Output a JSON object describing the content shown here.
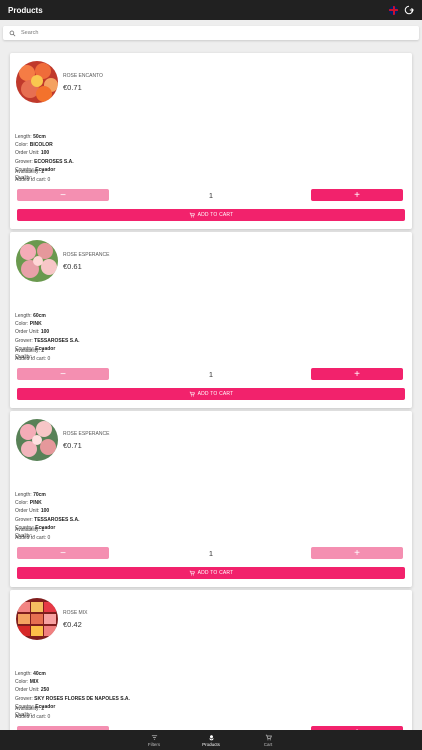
{
  "header": {
    "title": "Products"
  },
  "search": {
    "placeholder": "Search"
  },
  "labels": {
    "length": "Length:",
    "color": "Color:",
    "order_unit": "Order Unit:",
    "grower": "Grower:",
    "country": "Country:",
    "quality": "Quality:",
    "availability": "Availability:",
    "added_to_cart": "Added to cart:",
    "add_to_cart": "ADD TO CART",
    "minus": "−",
    "plus": "+"
  },
  "products": [
    {
      "name": "ROSE ENCANTO",
      "price": "€0.71",
      "length": "50cm",
      "color": "BICOLOR",
      "order_unit": "100",
      "grower": "ECOROSES S.A.",
      "country": "Ecuador",
      "quality": "-",
      "availability": "2",
      "added_to_cart": "0",
      "quantity": "1",
      "plus_enabled": true
    },
    {
      "name": "ROSE ESPERANCE",
      "price": "€0.61",
      "length": "60cm",
      "color": "PINK",
      "order_unit": "100",
      "grower": "TESSAROSES S.A.",
      "country": "Ecuador",
      "quality": "-",
      "availability": "2",
      "added_to_cart": "0",
      "quantity": "1",
      "plus_enabled": true
    },
    {
      "name": "ROSE ESPERANCE",
      "price": "€0.71",
      "length": "70cm",
      "color": "PINK",
      "order_unit": "100",
      "grower": "TESSAROSES S.A.",
      "country": "Ecuador",
      "quality": "-",
      "availability": "1",
      "added_to_cart": "0",
      "quantity": "1",
      "plus_enabled": false
    },
    {
      "name": "ROSE MIX",
      "price": "€0.42",
      "length": "40cm",
      "color": "MIX",
      "order_unit": "250",
      "grower": "SKY ROSES FLORES DE NAPOLES S.A.",
      "country": "Ecuador",
      "quality": "-",
      "availability": "2",
      "added_to_cart": "0",
      "quantity": "1",
      "plus_enabled": true
    }
  ],
  "bottom_nav": [
    {
      "label": "Filters",
      "icon": "filter-icon",
      "active": false
    },
    {
      "label": "Products",
      "icon": "flower-icon",
      "active": true
    },
    {
      "label": "Cart",
      "icon": "cart-icon",
      "active": false
    }
  ],
  "colors": {
    "accent": "#f2226c",
    "accent_light": "#f48fb1",
    "bar": "#212121"
  }
}
